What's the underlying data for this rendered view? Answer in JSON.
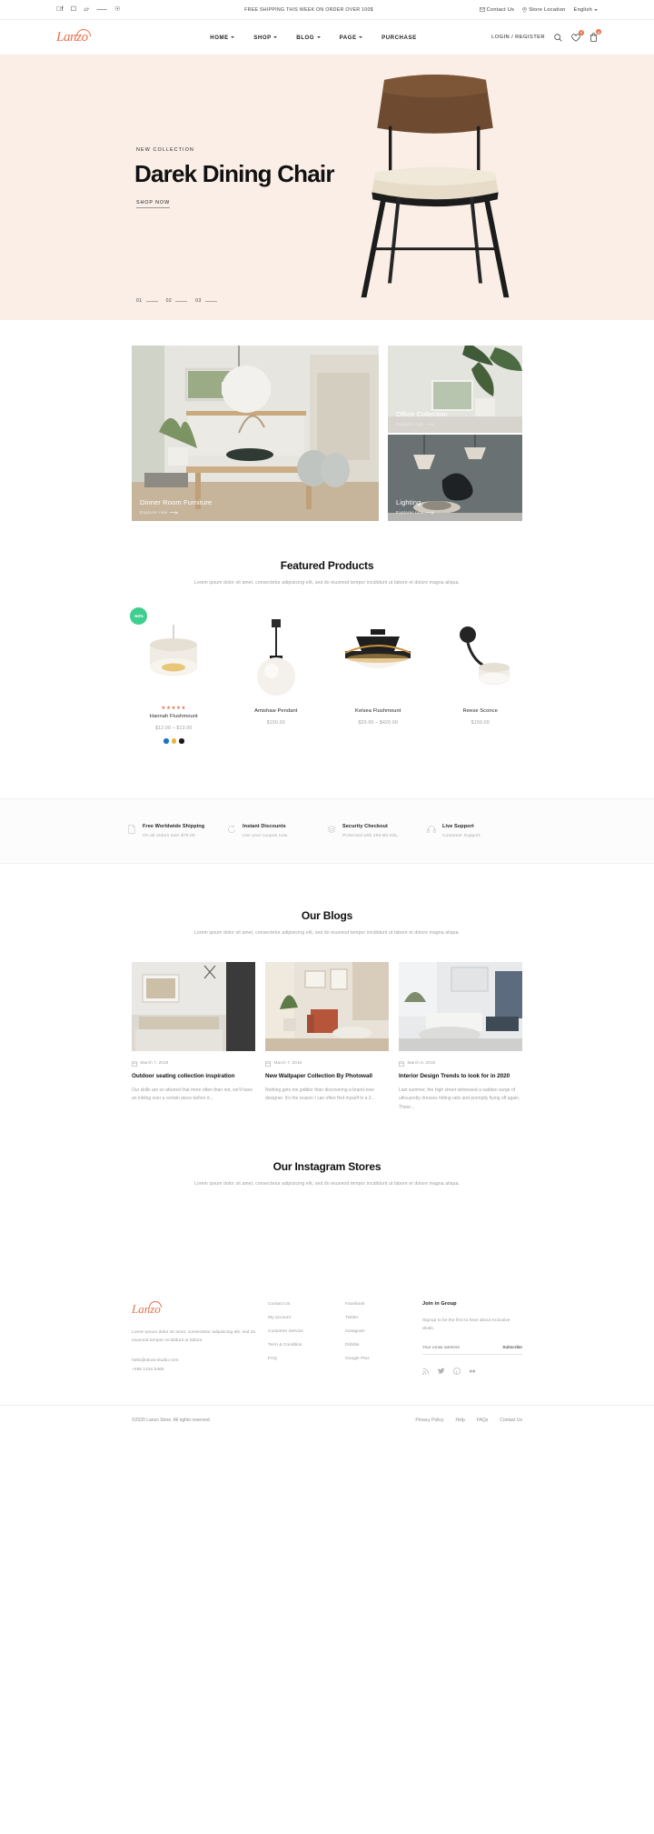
{
  "topbar": {
    "social": [
      "facebook-icon",
      "instagram-icon",
      "behance-icon",
      "twitter-icon",
      "pinterest-icon"
    ],
    "promo": "FREE SHIPPING THIS WEEK ON ORDER OVER 100$",
    "contact": "Contact Us",
    "store_location": "Store Location",
    "language": "English"
  },
  "header": {
    "logo": "Lanzo",
    "nav": [
      {
        "label": "HOME",
        "caret": true
      },
      {
        "label": "SHOP",
        "caret": true
      },
      {
        "label": "BLOG",
        "caret": true
      },
      {
        "label": "PAGE",
        "caret": true
      },
      {
        "label": "PURCHASE",
        "caret": false
      }
    ],
    "account": "LOGIN / REGISTER",
    "wishlist_count": "0",
    "cart_count": "0"
  },
  "hero": {
    "eyebrow": "NEW COLLECTION",
    "title": "Darek Dining Chair",
    "cta": "SHOP NOW",
    "slides": [
      "01",
      "02",
      "03"
    ],
    "bg_color": "#faeee6"
  },
  "categories": [
    {
      "label": "Dinner Room Furniture",
      "sub": "Explorer now"
    },
    {
      "label": "Office Collection",
      "sub": "Explorer now"
    },
    {
      "label": "Lighting",
      "sub": "Explorer now"
    }
  ],
  "featured": {
    "title": "Featured Products",
    "subtitle": "Lorem ipsum dolor sit amet, consectetur adipisicing elit, sed do eiusmod tempor incididunt ut labore et dolore magna aliqua.",
    "products": [
      {
        "name": "Hannah Flushmount",
        "price": "$12.00 – $13.00",
        "rating": "★★★★★",
        "badge": "-64%",
        "badge_color": "#3ecf8e",
        "swatches": [
          "#1a73c8",
          "#e8b63a",
          "#1a1a1a"
        ]
      },
      {
        "name": "Amishaw Pendant",
        "price": "$150.00",
        "rating": "",
        "badge": "",
        "swatches": []
      },
      {
        "name": "Kelsea Flushmount",
        "price": "$20.00 – $420.00",
        "rating": "",
        "badge": "",
        "swatches": []
      },
      {
        "name": "Reese Sconce",
        "price": "$150.00",
        "rating": "",
        "badge": "",
        "swatches": []
      }
    ]
  },
  "services": [
    {
      "icon": "document-icon",
      "title": "Free Worldwide Shipping",
      "sub": "On all orders over $75.00"
    },
    {
      "icon": "refresh-icon",
      "title": "Instant Discounts",
      "sub": "Use your coupon now."
    },
    {
      "icon": "layers-icon",
      "title": "Security Checkout",
      "sub": "Protected with 256-Bit SSL."
    },
    {
      "icon": "headset-icon",
      "title": "Live Support",
      "sub": "Customer Support."
    }
  ],
  "blogs": {
    "title": "Our Blogs",
    "subtitle": "Lorem ipsum dolor sit amet, consectetur adipisicing elit, sed do eiusmod tempor incididunt ut labore et dolore magna aliqua.",
    "posts": [
      {
        "date": "March 7, 2018",
        "title": "Outdoor seating collection inspiration",
        "excerpt": "Our skills are so attuned that more often than not, we'll have an inkling over a certain piece before it..."
      },
      {
        "date": "March 7, 2018",
        "title": "New Wallpaper Collection By Photowall",
        "excerpt": "Nothing gets me giddier than discovering a brand-new designer. It's the reason I can often find myself in a 2..."
      },
      {
        "date": "March 6, 2018",
        "title": "Interior Design Trends to look for in 2020",
        "excerpt": "Last summer, the high street witnessed a sudden surge of ultra-pretty dresses hitting rails and promptly flying off again. There..."
      }
    ]
  },
  "instagram": {
    "title": "Our Instagram Stores",
    "subtitle": "Lorem ipsum dolor sit amet, consectetur adipisicing elit, sed do eiusmod tempor incididunt ut labore et dolore magna aliqua."
  },
  "footer": {
    "logo": "Lanzo",
    "description": "Lorem ipsum dolor sit amet, consectetur adipisicing elit, sed do eiusmod tempor incididunt ut labore",
    "email": "hello@alura-studio.com",
    "phone": "+486 1234 5465",
    "col1": [
      "Contact Us",
      "My account",
      "Customer Service",
      "Term & Condition",
      "FAQ"
    ],
    "col2": [
      "Facebook",
      "Twitter",
      "Instagram",
      "Dribble",
      "Google Plus"
    ],
    "newsletter": {
      "title": "Join in Group",
      "text": "Signup to be the first to hear about exclusive deals.",
      "placeholder": "Your email address",
      "button": "Subscribe"
    },
    "socials": [
      "rss-icon",
      "twitter-icon",
      "pinterest-icon",
      "flickr-icon"
    ],
    "copyright": "©2020 Lanzo Store. All rights reserved.",
    "links": [
      "Privacy Policy",
      "Help",
      "FAQs",
      "Contact Us"
    ]
  }
}
